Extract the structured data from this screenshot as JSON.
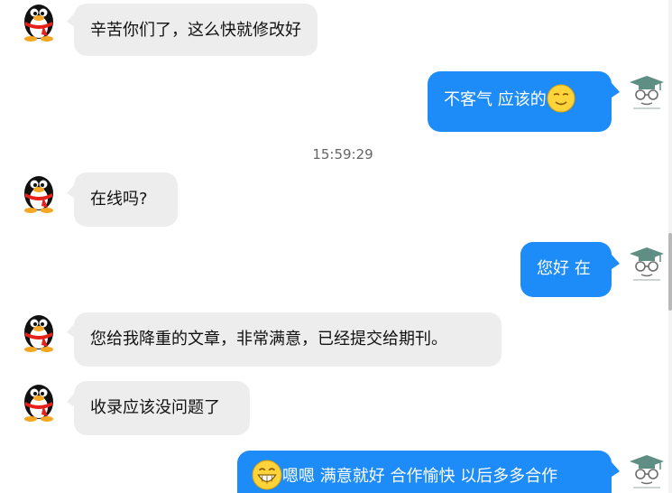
{
  "conversation": {
    "messages": [
      {
        "direction": "in",
        "text": "辛苦你们了，这么快就修改好",
        "avatar": "qq-penguin-icon"
      },
      {
        "direction": "out",
        "text": "不客气 应该的",
        "emoji_after": "smile-emoji",
        "avatar": "graduate-cap-avatar"
      },
      {
        "direction": "in",
        "text": "在线吗?",
        "avatar": "qq-penguin-icon"
      },
      {
        "direction": "out",
        "text": "您好 在",
        "avatar": "graduate-cap-avatar"
      },
      {
        "direction": "in",
        "text": "您给我降重的文章，非常满意，已经提交给期刊。",
        "avatar": "qq-penguin-icon"
      },
      {
        "direction": "in",
        "text": "收录应该没问题了",
        "avatar": "qq-penguin-icon"
      },
      {
        "direction": "out",
        "text": "嗯嗯 满意就好 合作愉快 以后多多合作",
        "emoji_before": "grin-emoji",
        "avatar": "graduate-cap-avatar"
      }
    ],
    "timestamp": "15:59:29"
  },
  "colors": {
    "incoming_bubble": "#ededed",
    "outgoing_bubble": "#1d8cf8",
    "timestamp_text": "#666666"
  }
}
